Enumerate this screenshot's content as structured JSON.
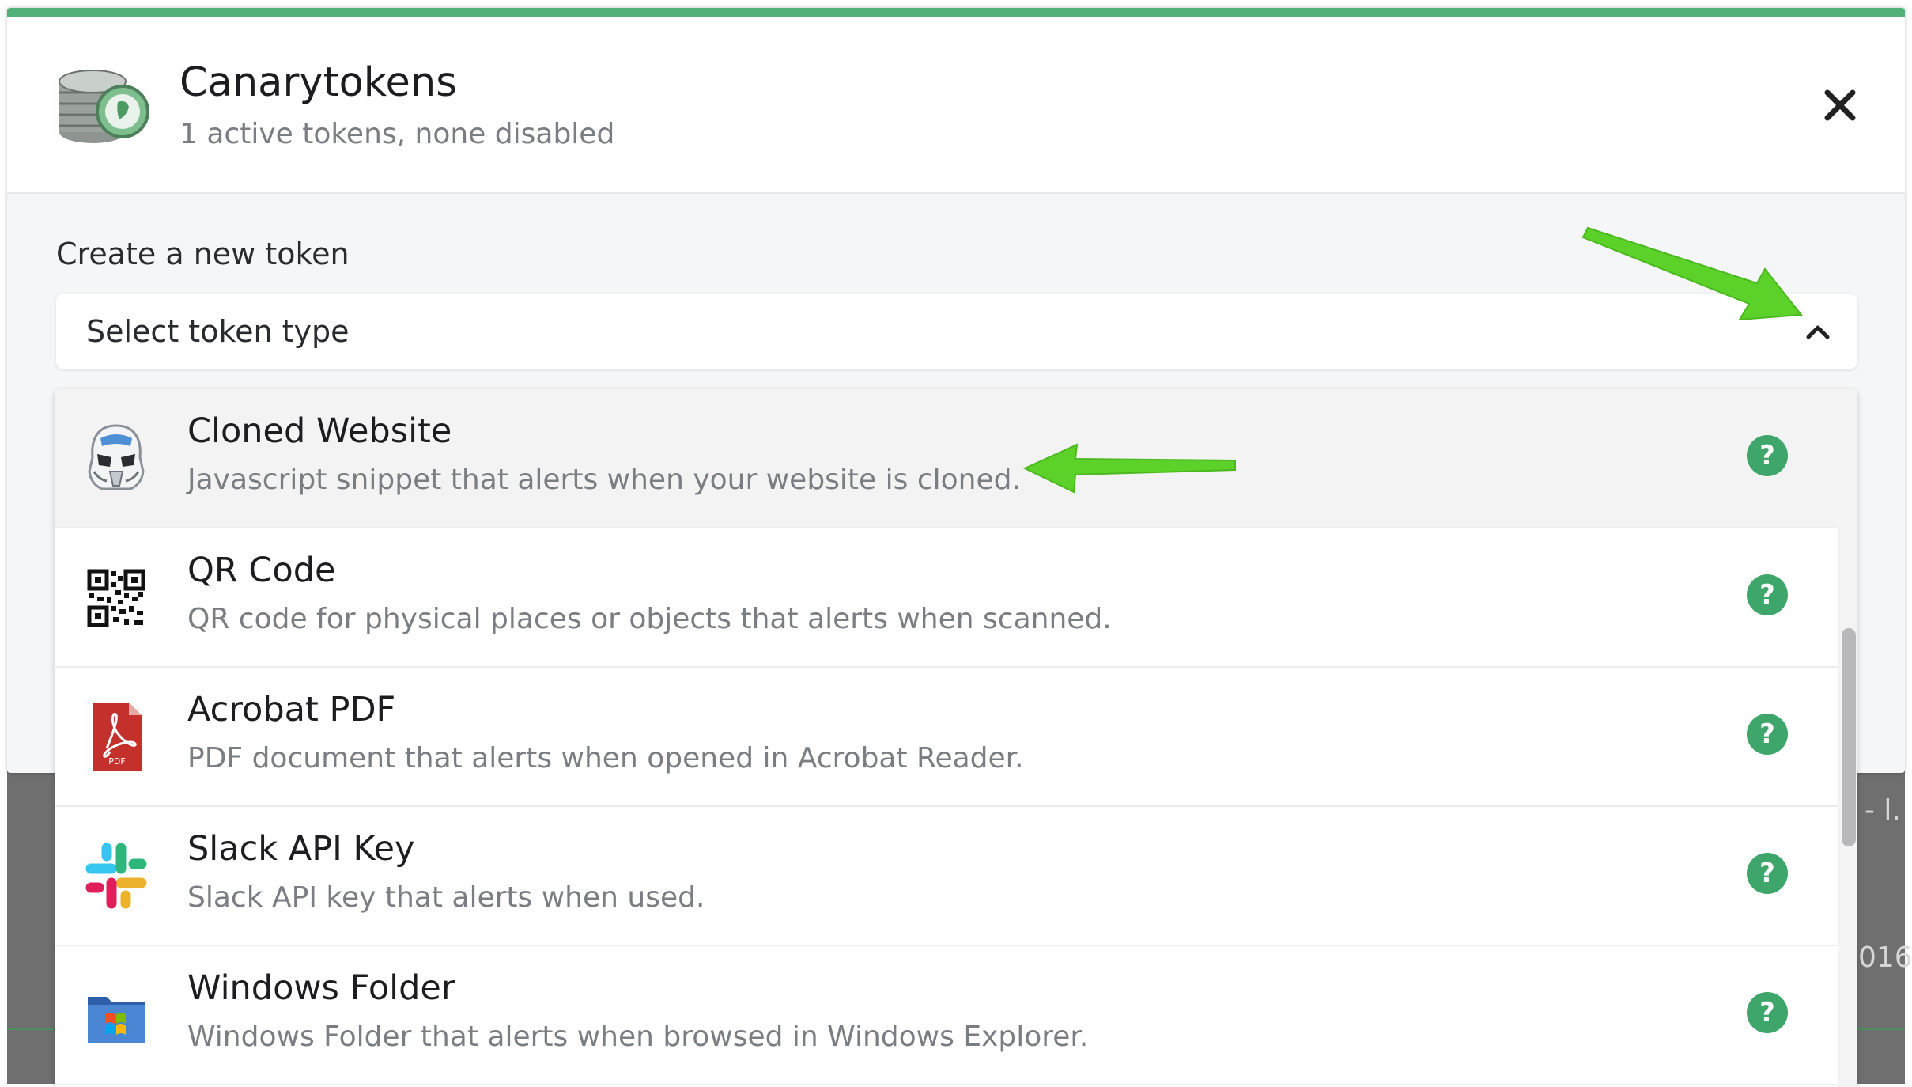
{
  "header": {
    "title": "Canarytokens",
    "subtitle": "1 active tokens, none disabled"
  },
  "create": {
    "label": "Create a new token",
    "select_placeholder": "Select token type"
  },
  "options": [
    {
      "title": "Cloned Website",
      "description": "Javascript snippet that alerts when your website is cloned.",
      "icon": "trooper-helmet-icon"
    },
    {
      "title": "QR Code",
      "description": "QR code for physical places or objects that alerts when scanned.",
      "icon": "qr-code-icon"
    },
    {
      "title": "Acrobat PDF",
      "description": "PDF document that alerts when opened in Acrobat Reader.",
      "icon": "pdf-icon"
    },
    {
      "title": "Slack API Key",
      "description": "Slack API key that alerts when used.",
      "icon": "slack-icon"
    },
    {
      "title": "Windows Folder",
      "description": "Windows Folder that alerts when browsed in Windows Explorer.",
      "icon": "windows-folder-icon"
    }
  ],
  "pdf_badge": "PDF",
  "help_glyph": "?",
  "backdrop": {
    "fragment_a": "- l.",
    "fragment_b": "016"
  },
  "colors": {
    "accent": "#52b178",
    "help": "#3fa66b",
    "annotation_arrow": "#5cd12a"
  }
}
